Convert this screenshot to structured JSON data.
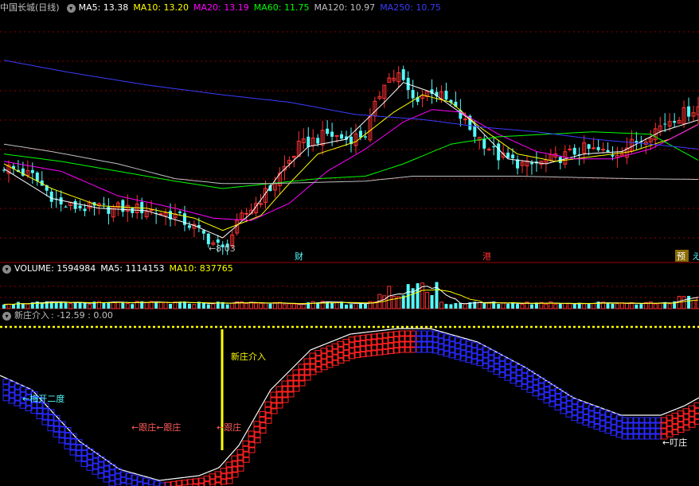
{
  "header": {
    "stock_name": "中国长城",
    "period": "(日线)",
    "ma": [
      {
        "label": "MA5: 13.38",
        "color": "#ffffff"
      },
      {
        "label": "MA10: 13.20",
        "color": "#ffff00"
      },
      {
        "label": "MA20: 13.19",
        "color": "#ff00ff"
      },
      {
        "label": "MA60: 11.75",
        "color": "#00ff00"
      },
      {
        "label": "MA120: 10.97",
        "color": "#c0c0c0"
      },
      {
        "label": "MA250: 10.75",
        "color": "#3b3bff"
      }
    ]
  },
  "volume_header": {
    "items": [
      {
        "label": "VOLUME: 1594984",
        "color": "#ffffff"
      },
      {
        "label": "MA5: 1114153",
        "color": "#ffffff"
      },
      {
        "label": "MA10: 837765",
        "color": "#ffff00"
      }
    ]
  },
  "indicator_header": {
    "name": "新庄介入",
    "values": ": -12.59 : 0.00"
  },
  "annotations": {
    "low_price": "←8.03",
    "event_cai": "财",
    "event_gang": "港",
    "event_yu": "预",
    "event_edge": "え",
    "plum_label": "←梅开二度",
    "follow_label": "←跟庄←跟庄",
    "follow_label2": "←跟庄",
    "entry_label": "新庄介入",
    "ding_label": "←叮庄"
  },
  "colors": {
    "up": "#ff3232",
    "down": "#54fcfc",
    "ma5": "#ffffff",
    "ma10": "#ffff00",
    "ma20": "#ff00ff",
    "ma60": "#00ff00",
    "ma120": "#c0c0c0",
    "ma250": "#3b3bff",
    "grid": "#8b0000",
    "signal": "#ffff00",
    "wave": "#ffffff",
    "block_up": "#ff2020",
    "block_down": "#2828ff"
  },
  "chart_data": [
    {
      "type": "candlestick",
      "title": "中国长城 (日线)",
      "ylim": [
        7.6,
        17.6
      ],
      "min_label_value": 8.03,
      "close_path": [
        [
          0,
          11.5
        ],
        [
          6,
          11.1
        ],
        [
          12,
          9.9
        ],
        [
          18,
          9.8
        ],
        [
          24,
          9.8
        ],
        [
          30,
          9.75
        ],
        [
          36,
          9.5
        ],
        [
          40,
          9.0
        ],
        [
          44,
          8.4
        ],
        [
          46,
          8.1
        ],
        [
          50,
          9.4
        ],
        [
          56,
          10.6
        ],
        [
          62,
          12.3
        ],
        [
          68,
          12.8
        ],
        [
          72,
          12.6
        ],
        [
          76,
          12.8
        ],
        [
          80,
          15.0
        ],
        [
          83,
          15.2
        ],
        [
          86,
          14.2
        ],
        [
          90,
          14.6
        ],
        [
          94,
          14.0
        ],
        [
          98,
          13.0
        ],
        [
          104,
          11.9
        ],
        [
          110,
          11.5
        ],
        [
          116,
          11.8
        ],
        [
          122,
          12.2
        ],
        [
          128,
          12.0
        ],
        [
          134,
          12.6
        ],
        [
          140,
          13.4
        ],
        [
          146,
          13.9
        ]
      ],
      "ma_series": [
        {
          "name": "MA5",
          "values": [
            [
              0,
              11.4
            ],
            [
              10,
              10.2
            ],
            [
              20,
              9.8
            ],
            [
              30,
              9.7
            ],
            [
              40,
              9.1
            ],
            [
              46,
              8.6
            ],
            [
              52,
              9.6
            ],
            [
              58,
              11.2
            ],
            [
              64,
              12.3
            ],
            [
              72,
              12.6
            ],
            [
              80,
              14.1
            ],
            [
              84,
              14.9
            ],
            [
              90,
              14.5
            ],
            [
              98,
              13.4
            ],
            [
              106,
              11.8
            ],
            [
              114,
              11.6
            ],
            [
              122,
              12.0
            ],
            [
              130,
              12.1
            ],
            [
              138,
              12.9
            ],
            [
              146,
              13.38
            ]
          ]
        },
        {
          "name": "MA10",
          "values": [
            [
              0,
              11.6
            ],
            [
              10,
              10.6
            ],
            [
              20,
              9.9
            ],
            [
              30,
              9.8
            ],
            [
              40,
              9.4
            ],
            [
              46,
              8.9
            ],
            [
              54,
              9.5
            ],
            [
              60,
              10.8
            ],
            [
              66,
              12.0
            ],
            [
              74,
              12.5
            ],
            [
              82,
              13.7
            ],
            [
              88,
              14.4
            ],
            [
              94,
              14.1
            ],
            [
              100,
              13.1
            ],
            [
              108,
              12.0
            ],
            [
              116,
              11.7
            ],
            [
              124,
              11.9
            ],
            [
              132,
              12.1
            ],
            [
              140,
              12.6
            ],
            [
              146,
              13.2
            ]
          ]
        },
        {
          "name": "MA20",
          "values": [
            [
              0,
              11.7
            ],
            [
              12,
              11.3
            ],
            [
              24,
              10.3
            ],
            [
              36,
              9.8
            ],
            [
              44,
              9.4
            ],
            [
              52,
              9.3
            ],
            [
              60,
              10.0
            ],
            [
              68,
              11.3
            ],
            [
              76,
              12.2
            ],
            [
              84,
              13.3
            ],
            [
              90,
              13.8
            ],
            [
              96,
              13.7
            ],
            [
              104,
              12.8
            ],
            [
              112,
              12.1
            ],
            [
              120,
              11.8
            ],
            [
              128,
              11.8
            ],
            [
              136,
              12.2
            ],
            [
              146,
              13.19
            ]
          ]
        },
        {
          "name": "MA60",
          "values": [
            [
              0,
              12.0
            ],
            [
              12,
              11.7
            ],
            [
              24,
              11.3
            ],
            [
              36,
              10.9
            ],
            [
              46,
              10.6
            ],
            [
              56,
              10.8
            ],
            [
              66,
              11.0
            ],
            [
              76,
              11.1
            ],
            [
              84,
              11.6
            ],
            [
              94,
              12.4
            ],
            [
              104,
              12.7
            ],
            [
              114,
              12.8
            ],
            [
              124,
              12.9
            ],
            [
              136,
              12.8
            ],
            [
              146,
              11.75
            ]
          ]
        },
        {
          "name": "MA120",
          "values": [
            [
              0,
              12.4
            ],
            [
              10,
              12.1
            ],
            [
              24,
              11.6
            ],
            [
              36,
              11.0
            ],
            [
              46,
              10.8
            ],
            [
              56,
              10.8
            ],
            [
              66,
              10.85
            ],
            [
              76,
              10.9
            ],
            [
              86,
              11.1
            ],
            [
              96,
              11.1
            ],
            [
              108,
              11.1
            ],
            [
              120,
              11.05
            ],
            [
              132,
              11.0
            ],
            [
              146,
              10.97
            ]
          ]
        },
        {
          "name": "MA250",
          "values": [
            [
              0,
              15.8
            ],
            [
              14,
              15.3
            ],
            [
              30,
              14.8
            ],
            [
              46,
              14.4
            ],
            [
              60,
              14.1
            ],
            [
              74,
              13.6
            ],
            [
              88,
              13.4
            ],
            [
              100,
              13.1
            ],
            [
              112,
              12.9
            ],
            [
              124,
              12.6
            ],
            [
              136,
              12.4
            ],
            [
              146,
              12.2
            ]
          ]
        }
      ]
    },
    {
      "type": "bar",
      "title": "VOLUME",
      "values": [
        1594984
      ],
      "ma": [
        {
          "name": "MA5",
          "value": 1114153
        },
        {
          "name": "MA10",
          "value": 837765
        }
      ]
    },
    {
      "type": "line",
      "title": "新庄介入",
      "values": [
        -12.59,
        0.0
      ]
    }
  ]
}
